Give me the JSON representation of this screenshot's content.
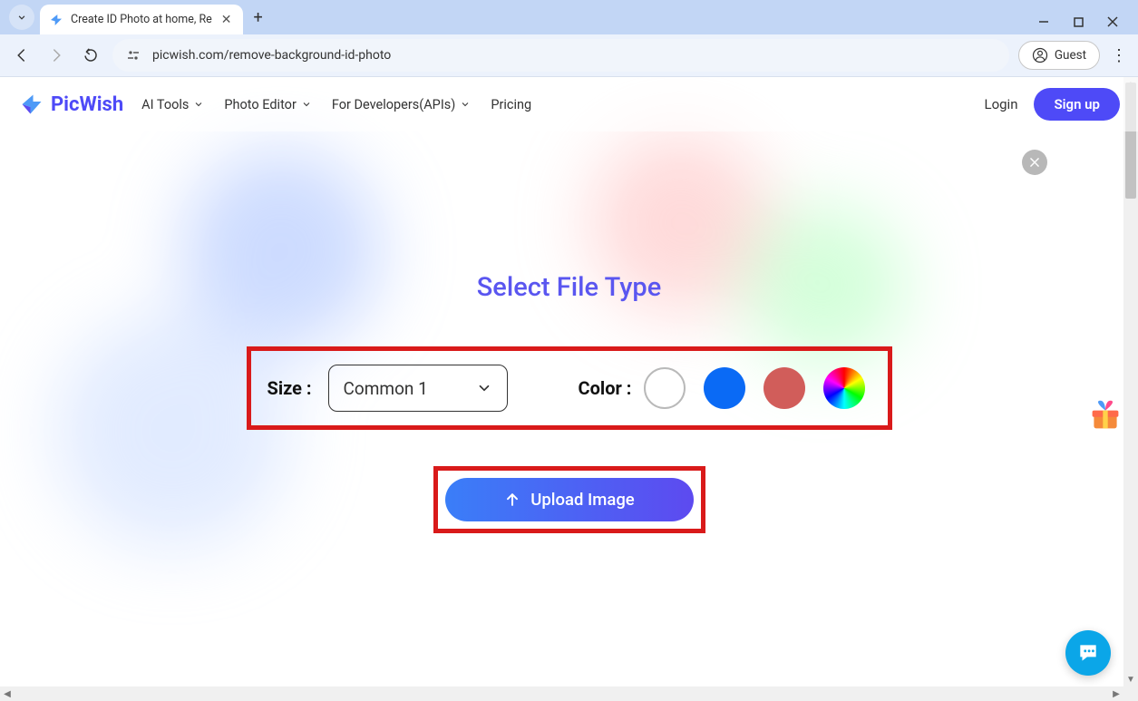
{
  "browser": {
    "tab_title": "Create ID Photo at home, Re",
    "url": "picwish.com/remove-background-id-photo",
    "guest_label": "Guest"
  },
  "header": {
    "brand": "PicWish",
    "nav": [
      "AI Tools",
      "Photo Editor",
      "For Developers(APIs)",
      "Pricing"
    ],
    "login_label": "Login",
    "signup_label": "Sign up"
  },
  "modal": {
    "title": "Select File Type",
    "size_label": "Size :",
    "size_selected": "Common 1",
    "color_label": "Color :",
    "colors": [
      {
        "name": "white",
        "hex": "#ffffff"
      },
      {
        "name": "blue",
        "hex": "#0a6af5"
      },
      {
        "name": "red",
        "hex": "#d15d5a"
      },
      {
        "name": "rainbow",
        "hex": "rainbow"
      }
    ],
    "upload_label": "Upload Image"
  }
}
